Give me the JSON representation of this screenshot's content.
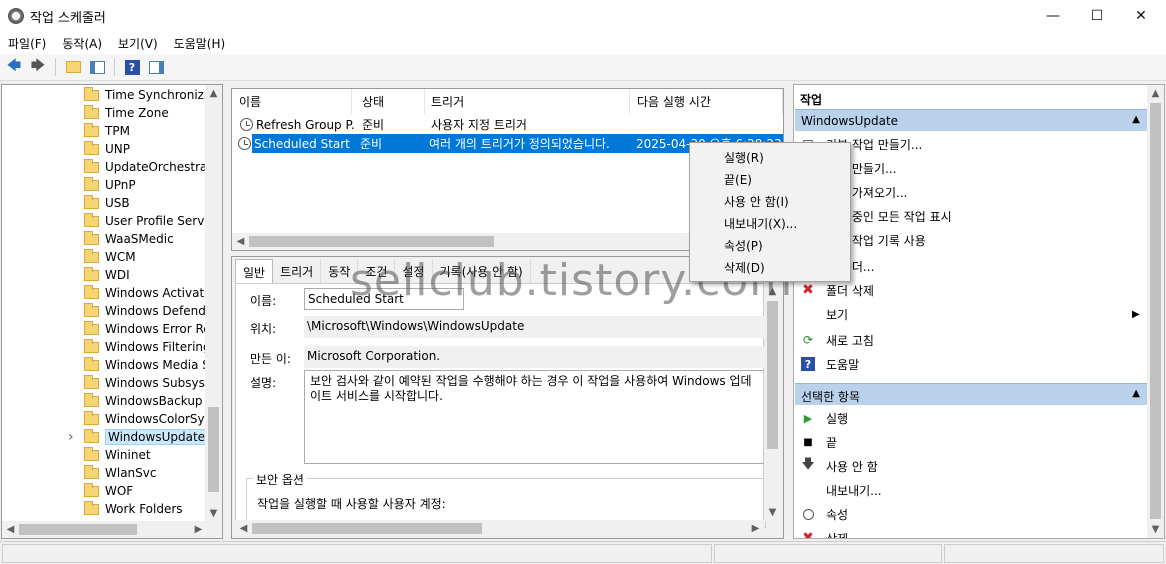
{
  "window": {
    "title": "작업 스케줄러"
  },
  "menu": [
    "파일(F)",
    "동작(A)",
    "보기(V)",
    "도움말(H)"
  ],
  "tree": {
    "items": [
      "Time Synchronizat",
      "Time Zone",
      "TPM",
      "UNP",
      "UpdateOrchestrato",
      "UPnP",
      "USB",
      "User Profile Service",
      "WaaSMedic",
      "WCM",
      "WDI",
      "Windows Activatio",
      "Windows Defender",
      "Windows Error Rep",
      "Windows Filtering",
      "Windows Media Sh",
      "Windows Subsyste",
      "WindowsBackup",
      "WindowsColorSyst",
      "WindowsUpdate",
      "Wininet",
      "WlanSvc",
      "WOF",
      "Work Folders"
    ],
    "selected": "WindowsUpdate"
  },
  "tasklist": {
    "columns": [
      "이름",
      "상태",
      "트리거",
      "다음 실행 시간"
    ],
    "rows": [
      {
        "name": "Refresh Group P...",
        "status": "준비",
        "trigger": "사용자 지정 트리거",
        "next": ""
      },
      {
        "name": "Scheduled Start",
        "status": "준비",
        "trigger": "여러 개의 트리거가 정의되었습니다.",
        "next": "2025-04-30 오후 6:28:23"
      }
    ]
  },
  "detail": {
    "tabs": [
      "일반",
      "트리거",
      "동작",
      "조건",
      "설정",
      "기록(사용 안 함)"
    ],
    "name_label": "이름:",
    "name_value": "Scheduled Start",
    "location_label": "위치:",
    "location_value": "\\Microsoft\\Windows\\WindowsUpdate",
    "author_label": "만든 이:",
    "author_value": "Microsoft Corporation.",
    "desc_label": "설명:",
    "desc_value": "보안 검사와 같이 예약된 작업을 수행해야 하는 경우 이 작업을 사용하여 Windows 업데이트 서비스를 시작합니다.",
    "security_group": "보안 옵션",
    "security_text": "작업을 실행할 때 사용할 사용자 계정:"
  },
  "actions": {
    "header": "작업",
    "section1": "WindowsUpdate",
    "items1": [
      "기본 작업 만들기...",
      "작업 만들기...",
      "작업 가져오기...",
      "실행 중인 모든 작업 표시",
      "모든 작업 기록 사용",
      "새 폴더...",
      "폴더 삭제",
      "보기",
      "새로 고침",
      "도움말"
    ],
    "section2": "선택한 항목",
    "items2": [
      "실행",
      "끝",
      "사용 안 함",
      "내보내기...",
      "속성",
      "삭제"
    ]
  },
  "context_menu": [
    "실행(R)",
    "끝(E)",
    "사용 안 함(I)",
    "내보내기(X)...",
    "속성(P)",
    "삭제(D)"
  ],
  "watermark": "sellclub.tistory.com",
  "colors": {
    "selection": "#0078d7",
    "section": "#b9d1ea"
  }
}
